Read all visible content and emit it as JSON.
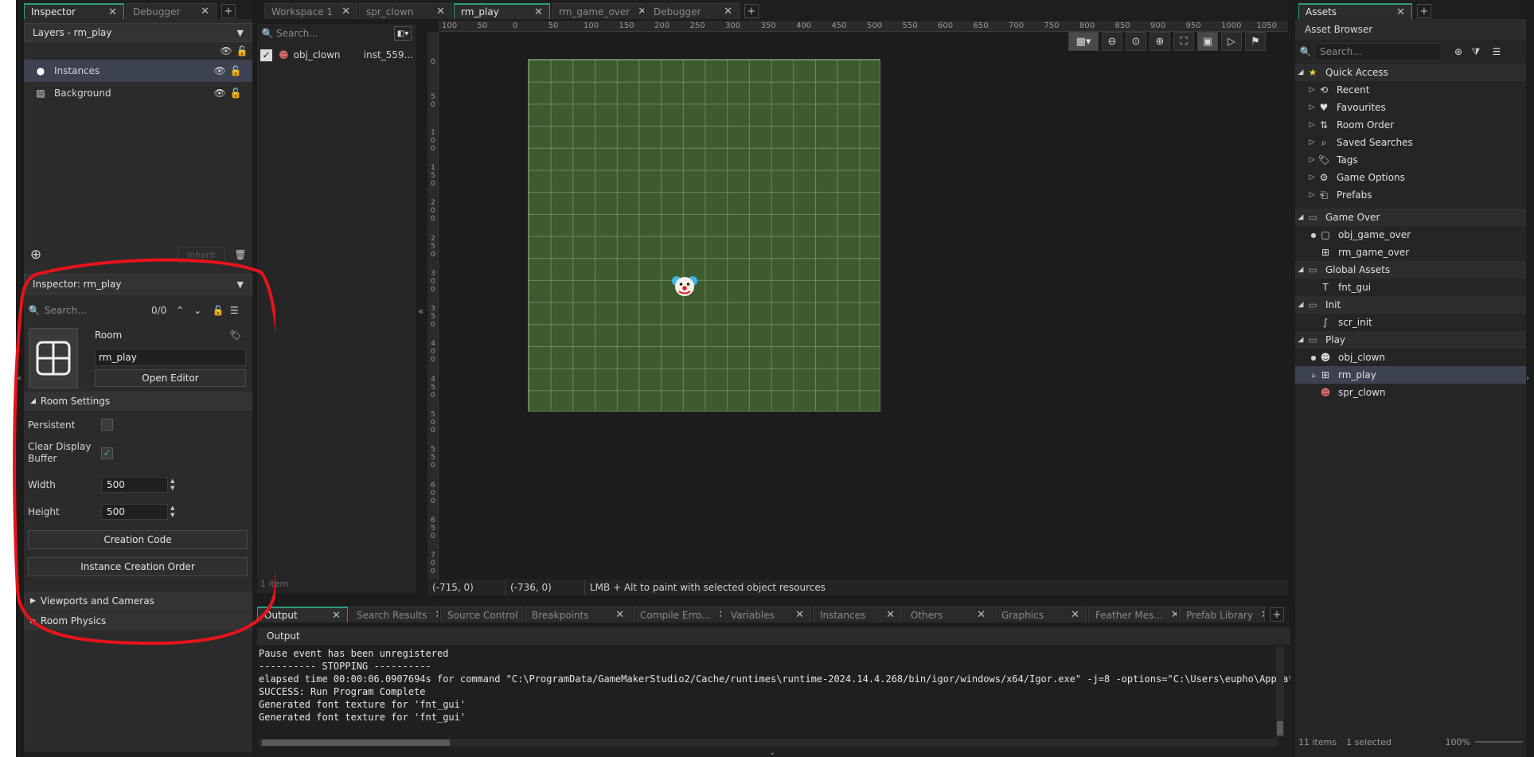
{
  "left_panel": {
    "tabs": [
      {
        "label": "Inspector",
        "active": true
      },
      {
        "label": "Debugger",
        "active": false
      }
    ],
    "layers_dropdown": "Layers - rm_play",
    "layers": [
      {
        "name": "Instances",
        "selected": true,
        "icon": "instances-icon"
      },
      {
        "name": "Background",
        "selected": false,
        "icon": "image-icon"
      }
    ],
    "inherit_label": "Inherit",
    "inspector_dropdown": "Inspector: rm_play",
    "search_placeholder": "Search...",
    "search_count": "0/0",
    "resource_type": "Room",
    "room_name": "rm_play",
    "open_editor": "Open Editor",
    "room_settings": "Room Settings",
    "persistent_label": "Persistent",
    "clear_display_label": "Clear Display Buffer",
    "width_label": "Width",
    "width_value": "500",
    "height_label": "Height",
    "height_value": "500",
    "creation_code": "Creation Code",
    "instance_creation_order": "Instance Creation Order",
    "viewports": "Viewports and Cameras",
    "room_physics": "Room Physics"
  },
  "editor_tabs": [
    {
      "label": "Workspace 1",
      "active": false
    },
    {
      "label": "spr_clown",
      "active": false
    },
    {
      "label": "rm_play",
      "active": true
    },
    {
      "label": "rm_game_over",
      "active": false
    },
    {
      "label": "Debugger",
      "active": false
    }
  ],
  "room_list": {
    "search_placeholder": "Search...",
    "instance_name": "obj_clown",
    "instance_id": "inst_559...",
    "footer": "1 item"
  },
  "ruler": {
    "h_labels": [
      "100",
      "50",
      "0",
      "50",
      "100",
      "150",
      "200",
      "250",
      "300",
      "350",
      "400",
      "450",
      "500",
      "550",
      "600",
      "650",
      "700",
      "750",
      "800",
      "850",
      "900",
      "950",
      "1000",
      "1050"
    ],
    "v_labels": [
      "0",
      "50",
      "100",
      "150",
      "200",
      "250",
      "300",
      "350",
      "400",
      "450",
      "500",
      "550",
      "600",
      "650",
      "700"
    ]
  },
  "status": {
    "coord1": "(-715, 0)",
    "coord2": "(-736, 0)",
    "hint": "LMB + Alt to paint with selected object resources"
  },
  "output": {
    "tabs": [
      {
        "label": "Output",
        "active": true
      },
      {
        "label": "Search Results",
        "active": false
      },
      {
        "label": "Source Control",
        "active": false
      },
      {
        "label": "Breakpoints",
        "active": false
      },
      {
        "label": "Compile Erro...",
        "active": false
      },
      {
        "label": "Variables",
        "active": false
      },
      {
        "label": "Instances",
        "active": false
      },
      {
        "label": "Others",
        "active": false
      },
      {
        "label": "Graphics",
        "active": false
      },
      {
        "label": "Feather Mes...",
        "active": false
      },
      {
        "label": "Prefab Library",
        "active": false
      }
    ],
    "header": "Output",
    "lines": [
      "Pause event has been unregistered",
      "---------- STOPPING ----------",
      "elapsed time 00:00:06.0907694s for command \"C:\\ProgramData/GameMakerStudio2/Cache/runtimes\\runtime-2024.14.4.268/bin/igor/windows/x64/Igor.exe\" -j=8  -options=\"C:\\Users\\eupho\\AppData\\",
      "SUCCESS: Run Program Complete",
      "Generated font texture for 'fnt_gui'",
      "Generated font texture for 'fnt_gui'"
    ]
  },
  "assets": {
    "tab": "Assets",
    "title": "Asset Browser",
    "search_placeholder": "Search...",
    "quick_access": "Quick Access",
    "quick_items": [
      "Recent",
      "Favourites",
      "Room Order",
      "Saved Searches",
      "Tags",
      "Game Options",
      "Prefabs"
    ],
    "groups": [
      {
        "name": "Game Over",
        "items": [
          "obj_game_over",
          "rm_game_over"
        ]
      },
      {
        "name": "Global Assets",
        "items": [
          "fnt_gui"
        ]
      },
      {
        "name": "Init",
        "items": [
          "scr_init"
        ]
      },
      {
        "name": "Play",
        "items": [
          "obj_clown",
          "rm_play",
          "spr_clown"
        ]
      }
    ],
    "footer_count": "11 items",
    "footer_selected": "1 selected",
    "zoom": "100%"
  },
  "colors": {
    "accent": "#2d9b7f",
    "annotation": "#e8131b",
    "room_bg": "#3e5a2f"
  }
}
